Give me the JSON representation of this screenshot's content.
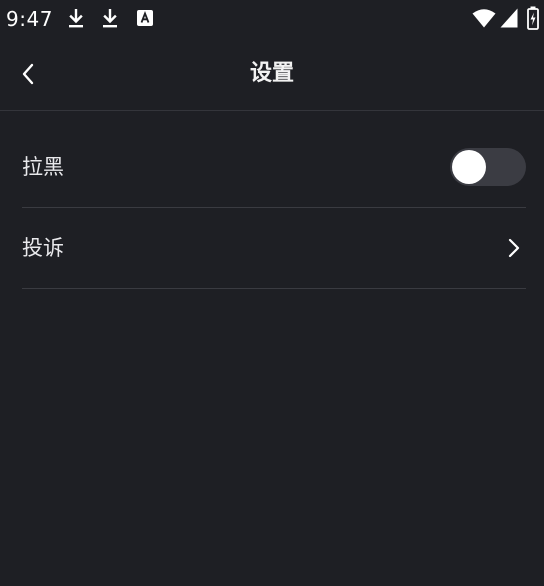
{
  "status_bar": {
    "time": "9:47",
    "icons": [
      "download-icon",
      "download-icon",
      "a-box-icon",
      "wifi-icon",
      "signal-icon",
      "battery-charging-icon"
    ]
  },
  "header": {
    "title": "设置",
    "back_icon": "back-chevron-icon"
  },
  "settings": {
    "items": [
      {
        "label": "拉黑",
        "control": "toggle",
        "enabled": false
      },
      {
        "label": "投诉",
        "control": "chevron"
      }
    ]
  },
  "colors": {
    "background": "#1e1f24",
    "divider": "#3a3b41",
    "toggle_track": "#3b3c43",
    "toggle_knob": "#ffffff",
    "text": "#e9e9ec"
  }
}
